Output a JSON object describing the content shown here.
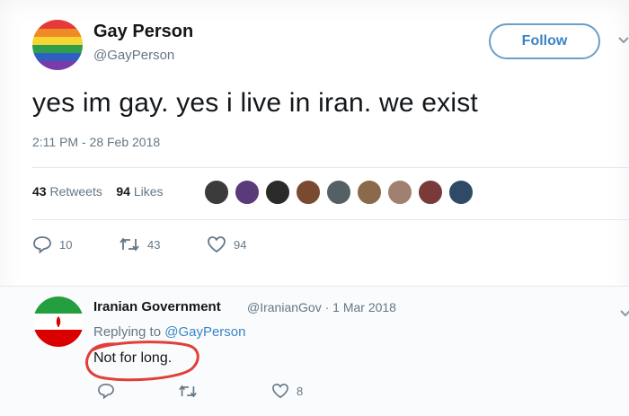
{
  "tweet": {
    "display_name": "Gay Person",
    "handle": "@GayPerson",
    "follow_label": "Follow",
    "text": "yes im gay. yes i live in iran. we exist",
    "timestamp": "2:11 PM - 28 Feb 2018",
    "retweets_count": "43",
    "retweets_label": "Retweets",
    "likes_count": "94",
    "likes_label": "Likes",
    "actions": {
      "replies": "10",
      "retweets": "43",
      "likes": "94"
    },
    "liker_colors": [
      "#3b3b3b",
      "#5a3a7a",
      "#2a2a2a",
      "#7a4a30",
      "#556066",
      "#8a6a4a",
      "#a08070",
      "#7a3a3a",
      "#2f4a66"
    ]
  },
  "reply": {
    "display_name": "Iranian Government",
    "handle": "@IranianGov",
    "date": "· 1 Mar 2018",
    "replying_prefix": "Replying to",
    "replying_to": "@GayPerson",
    "text": "Not for long.",
    "actions": {
      "likes": "8"
    }
  },
  "colors": {
    "accent": "#3b84c4",
    "annotation_circle": "#e0403a",
    "muted": "#657786"
  },
  "icons": [
    "chevron-down-icon",
    "reply-icon",
    "retweet-icon",
    "heart-icon"
  ]
}
